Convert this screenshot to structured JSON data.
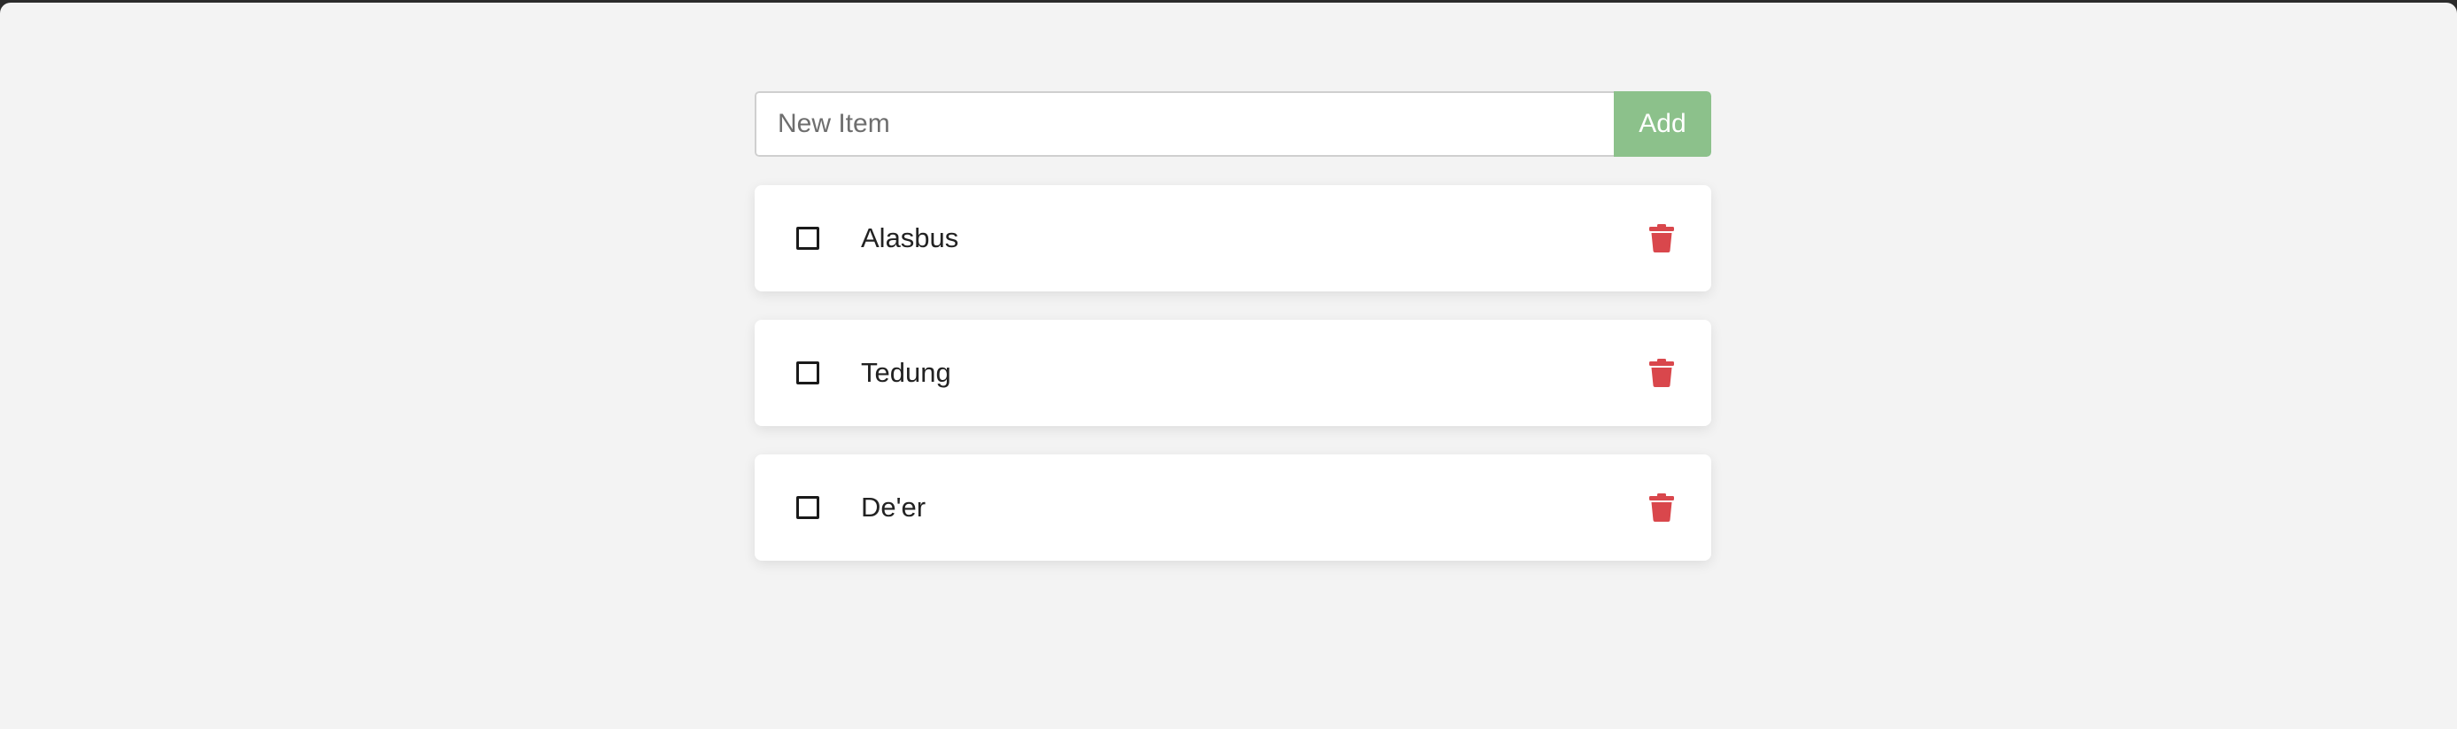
{
  "new_item": {
    "placeholder": "New Item",
    "value": "",
    "add_label": "Add"
  },
  "items": [
    {
      "label": "Alasbus",
      "checked": false
    },
    {
      "label": "Tedung",
      "checked": false
    },
    {
      "label": "De'er",
      "checked": false
    }
  ],
  "icons": {
    "delete": "trash-icon",
    "checkbox": "checkbox-icon"
  },
  "colors": {
    "accent": "#8cc18b",
    "delete": "#d9474c",
    "background": "#f3f3f3",
    "card": "#ffffff"
  }
}
